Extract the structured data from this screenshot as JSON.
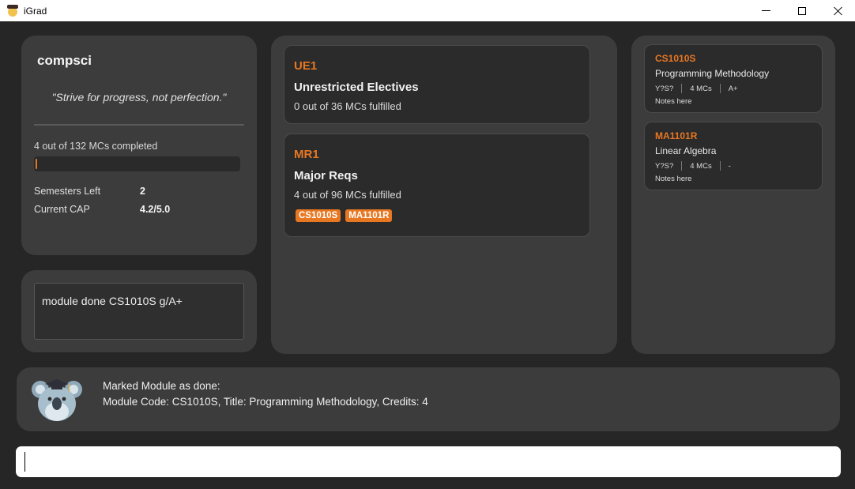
{
  "window": {
    "title": "iGrad",
    "app_icon": "graduate-cap-icon"
  },
  "profile": {
    "name": "compsci",
    "quote": "\"Strive for progress, not perfection.\"",
    "progress_text": "4 out of 132 MCs completed",
    "progress_fraction": 0.0303,
    "semesters_left_label": "Semesters Left",
    "semesters_left_value": "2",
    "cap_label": "Current CAP",
    "cap_value": "4.2/5.0",
    "accent_color": "#e87722"
  },
  "command_box": {
    "text": "module done CS1010S g/A+"
  },
  "requirements": [
    {
      "code": "UE1",
      "title": "Unrestricted Electives",
      "progress": "0 out of 36 MCs fulfilled",
      "tags": []
    },
    {
      "code": "MR1",
      "title": "Major Reqs",
      "progress": "4 out of 96 MCs fulfilled",
      "tags": [
        "CS1010S",
        "MA1101R"
      ]
    }
  ],
  "modules": [
    {
      "code": "CS1010S",
      "title": "Programming Methodology",
      "semester": "Y?S?",
      "credits": "4 MCs",
      "grade": "A+",
      "notes": "Notes here"
    },
    {
      "code": "MA1101R",
      "title": "Linear Algebra",
      "semester": "Y?S?",
      "credits": "4 MCs",
      "grade": "-",
      "notes": "Notes here"
    }
  ],
  "result": {
    "avatar": "koala-graduate-icon",
    "line1": "Marked Module as done:",
    "line2": "Module Code: CS1010S, Title: Programming Methodology, Credits: 4"
  },
  "command_input": {
    "value": "",
    "placeholder": ""
  }
}
